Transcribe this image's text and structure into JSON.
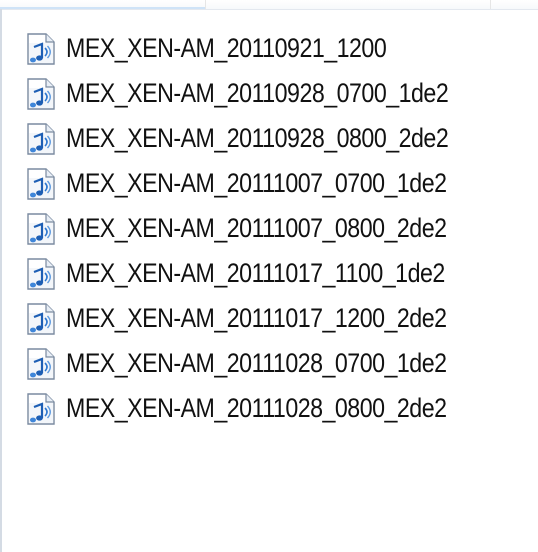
{
  "file_list": {
    "items": [
      {
        "name": "MEX_XEN-AM_20110921_1200",
        "icon": "audio-file-icon"
      },
      {
        "name": "MEX_XEN-AM_20110928_0700_1de2",
        "icon": "audio-file-icon"
      },
      {
        "name": "MEX_XEN-AM_20110928_0800_2de2",
        "icon": "audio-file-icon"
      },
      {
        "name": "MEX_XEN-AM_20111007_0700_1de2",
        "icon": "audio-file-icon"
      },
      {
        "name": "MEX_XEN-AM_20111007_0800_2de2",
        "icon": "audio-file-icon"
      },
      {
        "name": "MEX_XEN-AM_20111017_1100_1de2",
        "icon": "audio-file-icon"
      },
      {
        "name": "MEX_XEN-AM_20111017_1200_2de2",
        "icon": "audio-file-icon"
      },
      {
        "name": "MEX_XEN-AM_20111028_0700_1de2",
        "icon": "audio-file-icon"
      },
      {
        "name": "MEX_XEN-AM_20111028_0800_2de2",
        "icon": "audio-file-icon"
      }
    ]
  }
}
